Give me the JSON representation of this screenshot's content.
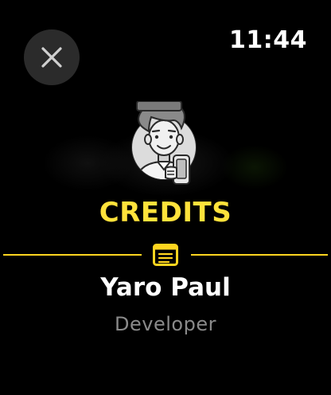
{
  "status_bar": {
    "time": "11:44"
  },
  "credits": {
    "title": "CREDITS",
    "name": "Yaro Paul",
    "role": "Developer"
  },
  "colors": {
    "accent": "#ffe23b",
    "background": "#000000",
    "close_button_bg": "#2b2b2b",
    "secondary_text": "#8a8a8a"
  },
  "icons": {
    "close": "close-icon",
    "avatar": "developer-avatar-icon",
    "notes": "notes-icon"
  }
}
